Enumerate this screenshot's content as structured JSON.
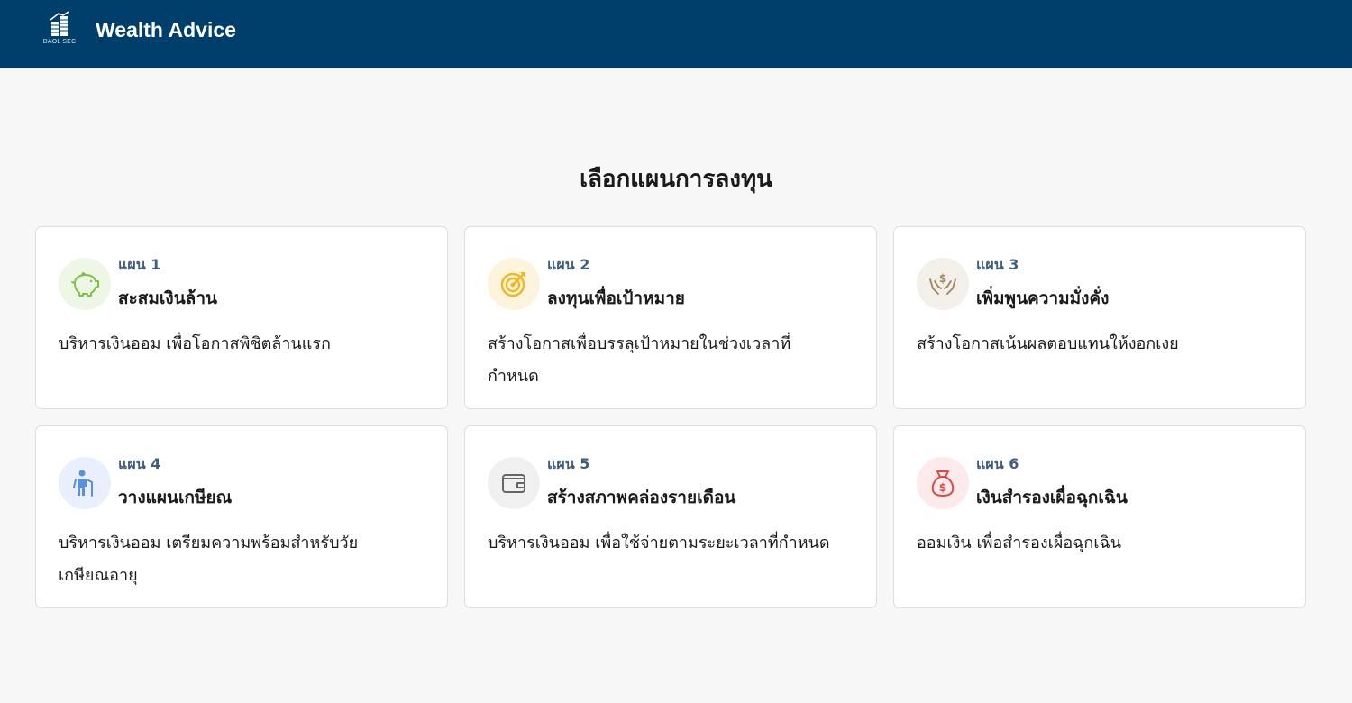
{
  "header": {
    "logo_text": "DAOL SEC",
    "title": "Wealth Advice",
    "background": "#003e6b"
  },
  "main": {
    "heading": "เลือกแผนการลงทุน"
  },
  "plans": [
    {
      "number_label": "แผน 1",
      "name": "สะสมเงินล้าน",
      "description": "บริหารเงินออม เพื่อโอกาสพิชิตล้านแรก",
      "icon": "piggy-bank-icon",
      "icon_bg": "#eef7e6",
      "icon_color": "#7cc24a"
    },
    {
      "number_label": "แผน 2",
      "name": "ลงทุนเพื่อเป้าหมาย",
      "description": "สร้างโอกาสเพื่อบรรลุเป้าหมายในช่วงเวลาที่กำหนด",
      "icon": "target-icon",
      "icon_bg": "#fdf4dd",
      "icon_color": "#f3b61f"
    },
    {
      "number_label": "แผน 3",
      "name": "เพิ่มพูนความมั่งคั่ง",
      "description": "สร้างโอกาสเน้นผลตอบแทนให้งอกเงย",
      "icon": "hands-money-icon",
      "icon_bg": "#f3efe9",
      "icon_color": "#a0825f"
    },
    {
      "number_label": "แผน 4",
      "name": "วางแผนเกษียณ",
      "description": "บริหารเงินออม เตรียมความพร้อมสำหรับวัยเกษียณอายุ",
      "icon": "elderly-person-icon",
      "icon_bg": "#eaf0fb",
      "icon_color": "#5b8fd8"
    },
    {
      "number_label": "แผน 5",
      "name": "สร้างสภาพคล่องรายเดือน",
      "description": "บริหารเงินออม เพื่อใช้จ่ายตามระยะเวลาที่กำหนด",
      "icon": "wallet-icon",
      "icon_bg": "#f0f0f0",
      "icon_color": "#666666"
    },
    {
      "number_label": "แผน 6",
      "name": "เงินสำรองเผื่อฉุกเฉิน",
      "description": "ออมเงิน เพื่อสำรองเผื่อฉุกเฉิน",
      "icon": "money-bag-icon",
      "icon_bg": "#fdeaea",
      "icon_color": "#e04848"
    }
  ]
}
